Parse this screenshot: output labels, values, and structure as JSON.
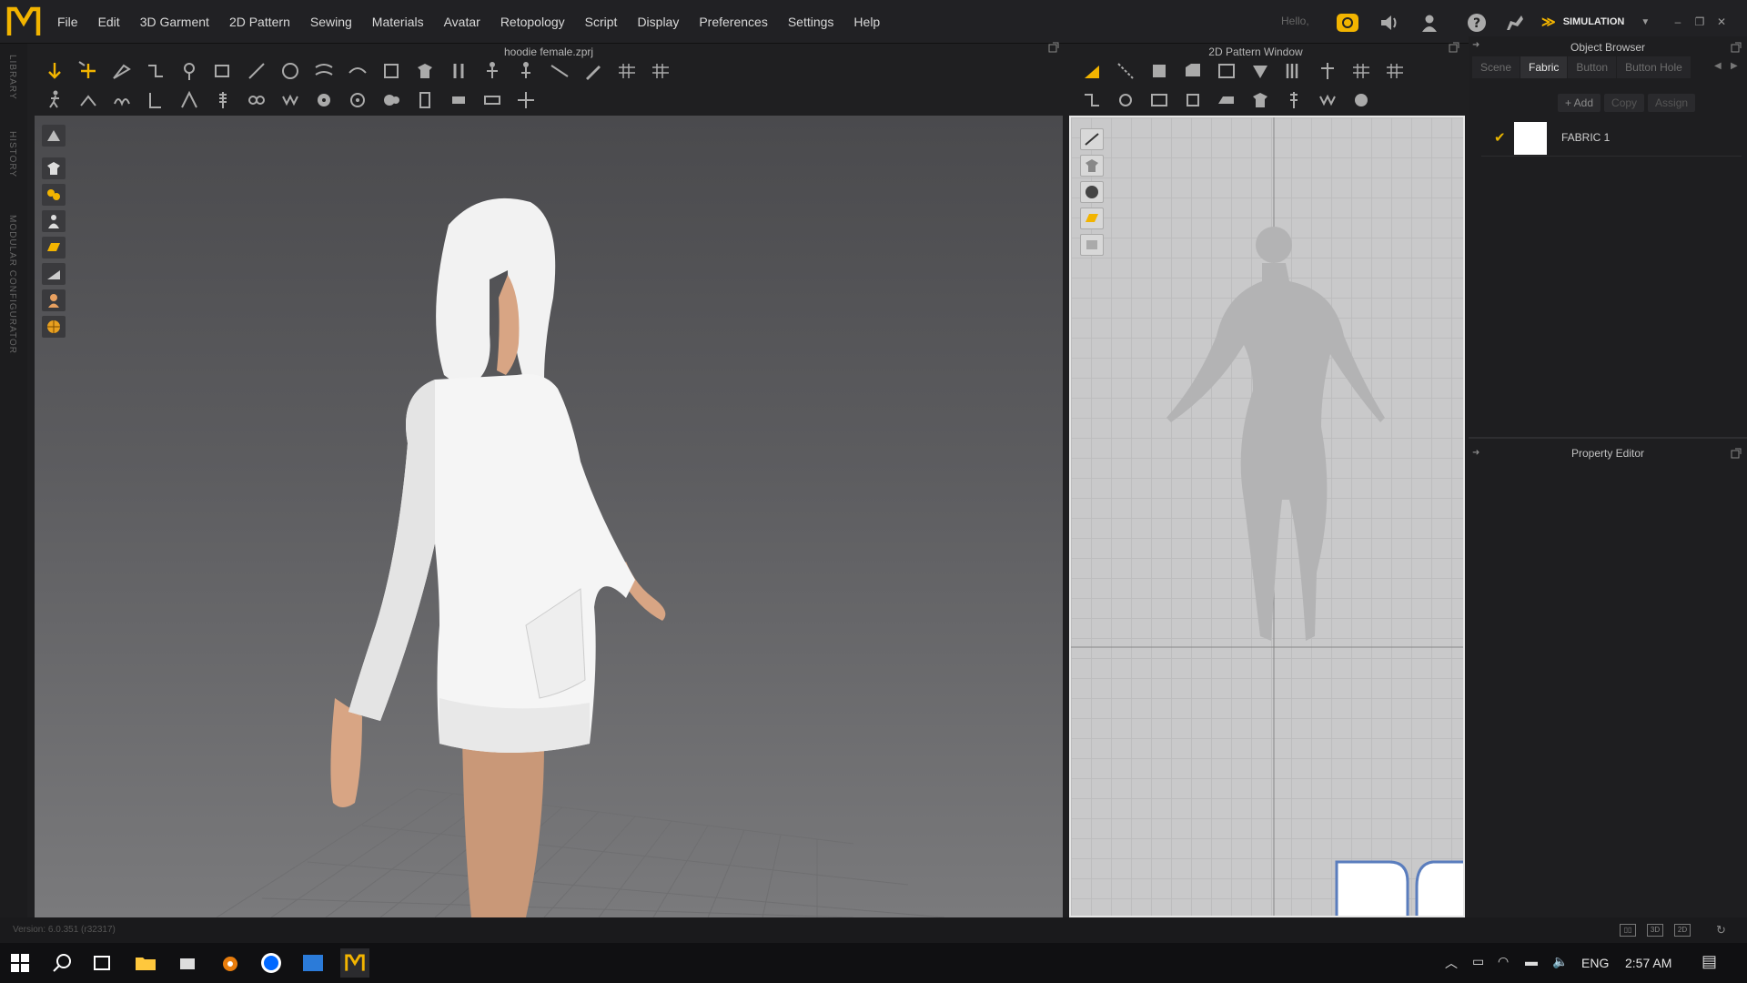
{
  "app": {
    "menus": [
      "File",
      "Edit",
      "3D Garment",
      "2D Pattern",
      "Sewing",
      "Materials",
      "Avatar",
      "Retopology",
      "Script",
      "Display",
      "Preferences",
      "Settings",
      "Help"
    ],
    "hello": "Hello,",
    "mode": "SIMULATION"
  },
  "left_strip": {
    "library": "LIBRARY",
    "history": "HISTORY",
    "modular": "MODULAR CONFIGURATOR"
  },
  "panel3d": {
    "title": "hoodie female.zprj"
  },
  "panel2d": {
    "title": "2D Pattern Window"
  },
  "object_browser": {
    "title": "Object Browser",
    "tabs": [
      "Scene",
      "Fabric",
      "Button",
      "Button Hole"
    ],
    "active_tab": "Fabric",
    "actions": {
      "add": "+ Add",
      "copy": "Copy",
      "assign": "Assign"
    },
    "fabric": {
      "name": "FABRIC 1",
      "color": "#ffffff"
    }
  },
  "property_editor": {
    "title": "Property Editor"
  },
  "status": {
    "version": "Version: 6.0.351 (r32317)"
  },
  "taskbar": {
    "lang": "ENG",
    "time": "2:57 AM"
  },
  "colors": {
    "accent": "#f2b400",
    "bg": "#212124"
  }
}
